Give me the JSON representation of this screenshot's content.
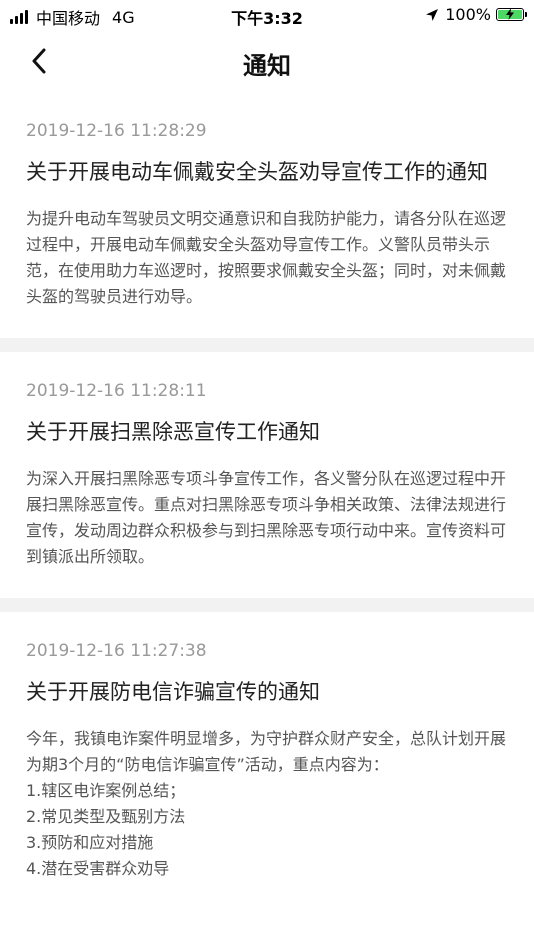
{
  "status_bar": {
    "carrier": "中国移动",
    "network": "4G",
    "time": "下午3:32",
    "battery": "100%",
    "battery_level": 1.0,
    "battery_color": "#4cd964"
  },
  "nav": {
    "back_icon": "chevron-left-icon",
    "title": "通知"
  },
  "notices": [
    {
      "time": "2019-12-16 11:28:29",
      "title": "关于开展电动车佩戴安全头盔劝导宣传工作的通知",
      "body": "为提升电动车驾驶员文明交通意识和自我防护能力，请各分队在巡逻过程中，开展电动车佩戴安全头盔劝导宣传工作。义警队员带头示范，在使用助力车巡逻时，按照要求佩戴安全头盔；同时，对未佩戴头盔的驾驶员进行劝导。"
    },
    {
      "time": "2019-12-16 11:28:11",
      "title": "关于开展扫黑除恶宣传工作通知",
      "body": "为深入开展扫黑除恶专项斗争宣传工作，各义警分队在巡逻过程中开展扫黑除恶宣传。重点对扫黑除恶专项斗争相关政策、法律法规进行宣传，发动周边群众积极参与到扫黑除恶专项行动中来。宣传资料可到镇派出所领取。"
    },
    {
      "time": "2019-12-16 11:27:38",
      "title": "关于开展防电信诈骗宣传的通知",
      "body": "今年，我镇电诈案件明显增多，为守护群众财产安全，总队计划开展为期3个月的“防电信诈骗宣传”活动，重点内容为：\n1.辖区电诈案例总结；\n2.常见类型及甄别方法\n3.预防和应对措施\n4.潜在受害群众劝导"
    }
  ]
}
